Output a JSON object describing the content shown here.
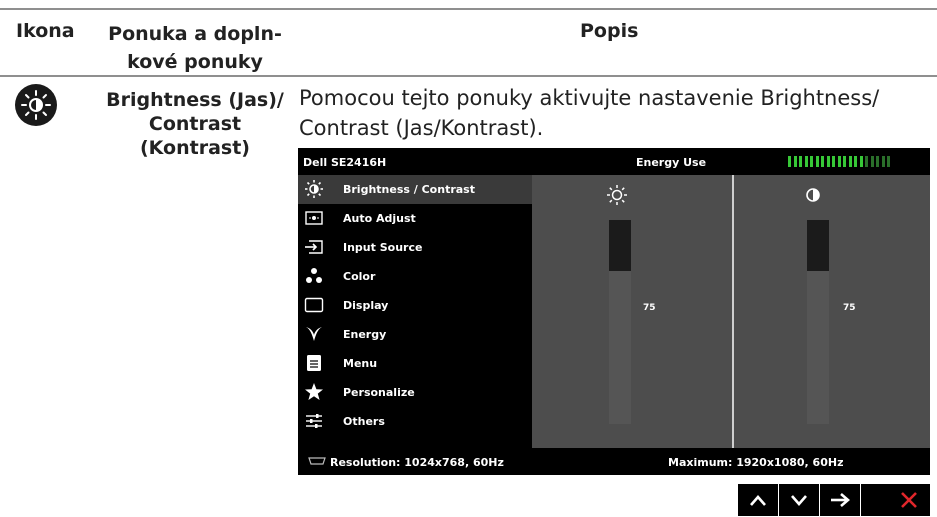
{
  "header": {
    "col_icon": "Ikona",
    "col_menu_line1": "Ponuka a dopln-",
    "col_menu_line2": "kové ponuky",
    "col_desc": "Popis"
  },
  "row": {
    "menu_line1": "Brightness (Jas)/",
    "menu_line2": "Contrast",
    "menu_line3": "(Kontrast)",
    "desc_line1": "Pomocou tejto ponuky aktivujte nastavenie Brightness/",
    "desc_line2": "Contrast (Jas/Kontrast)."
  },
  "osd": {
    "model": "Dell SE2416H",
    "energy_label": "Energy Use",
    "energy_segments_total": 19,
    "energy_segments_on": 14,
    "menu": [
      {
        "label": "Brightness / Contrast",
        "icon": "brightness-icon",
        "selected": true
      },
      {
        "label": "Auto Adjust",
        "icon": "auto-adjust-icon",
        "selected": false
      },
      {
        "label": "Input Source",
        "icon": "input-source-icon",
        "selected": false
      },
      {
        "label": "Color",
        "icon": "color-icon",
        "selected": false
      },
      {
        "label": "Display",
        "icon": "display-icon",
        "selected": false
      },
      {
        "label": "Energy",
        "icon": "energy-icon",
        "selected": false
      },
      {
        "label": "Menu",
        "icon": "menu-icon",
        "selected": false
      },
      {
        "label": "Personalize",
        "icon": "star-icon",
        "selected": false
      },
      {
        "label": "Others",
        "icon": "others-icon",
        "selected": false
      }
    ],
    "brightness_value": "75",
    "contrast_value": "75",
    "brightness_level": 75,
    "contrast_level": 75,
    "resolution": "Resolution: 1024x768, 60Hz",
    "maximum": "Maximum: 1920x1080, 60Hz"
  },
  "nav_buttons": [
    "up-arrow-icon",
    "down-arrow-icon",
    "right-arrow-icon",
    "close-icon"
  ],
  "colors": {
    "close": "#e0262b",
    "energy_on": "#37c837",
    "energy_off": "#2a6f2a"
  }
}
